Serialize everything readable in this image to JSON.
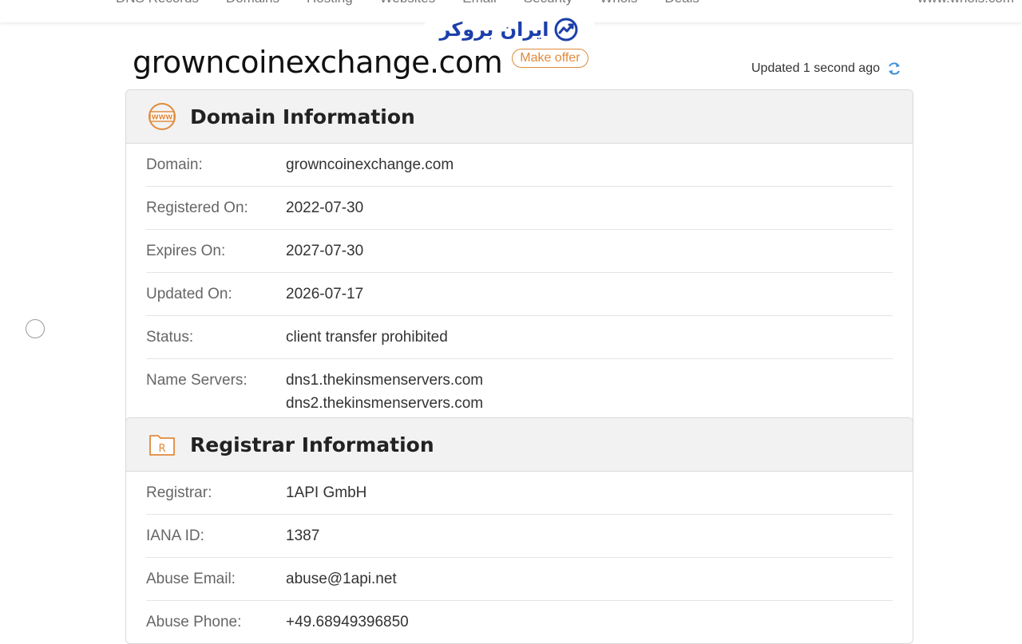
{
  "nav": {
    "items": [
      "DNS Records",
      "Domains",
      "Hosting",
      "Websites",
      "Email",
      "Security",
      "Whois",
      "Deals"
    ],
    "site": "www.whois.com"
  },
  "logo": {
    "text": "ایران بروکر"
  },
  "header": {
    "domain": "growncoinexchange.com",
    "make_offer": "Make offer",
    "updated": "Updated 1 second ago"
  },
  "domain_info": {
    "title": "Domain Information",
    "rows": [
      {
        "label": "Domain:",
        "value": "growncoinexchange.com"
      },
      {
        "label": "Registered On:",
        "value": "2022-07-30"
      },
      {
        "label": "Expires On:",
        "value": "2027-07-30"
      },
      {
        "label": "Updated On:",
        "value": "2026-07-17"
      },
      {
        "label": "Status:",
        "value": "client transfer prohibited"
      },
      {
        "label": "Name Servers:",
        "value": "dns1.thekinsmenservers.com",
        "value2": "dns2.thekinsmenservers.com"
      }
    ]
  },
  "registrar_info": {
    "title": "Registrar Information",
    "rows": [
      {
        "label": "Registrar:",
        "value": "1API GmbH"
      },
      {
        "label": "IANA ID:",
        "value": "1387"
      },
      {
        "label": "Abuse Email:",
        "value": "abuse@1api.net"
      },
      {
        "label": "Abuse Phone:",
        "value": "+49.68949396850"
      }
    ]
  },
  "colors": {
    "accent": "#e08a3c",
    "refresh": "#3b8fd9",
    "logo": "#1c3faa"
  },
  "icons": [
    "www-icon",
    "registrar-icon",
    "refresh-icon",
    "chart-logo-icon"
  ]
}
